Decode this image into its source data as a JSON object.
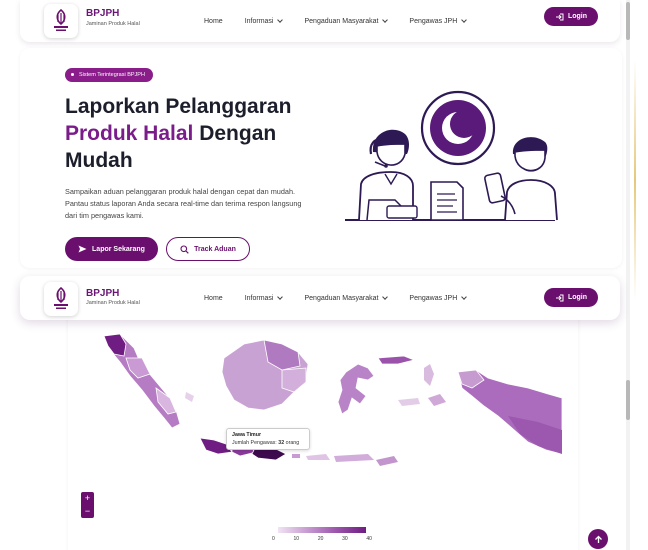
{
  "brand": {
    "name": "BPJPH",
    "subtitle": "Jaminan Produk Halal",
    "logo_icon": "halal-logo-icon"
  },
  "nav": {
    "items": [
      {
        "label": "Home",
        "has_dropdown": false
      },
      {
        "label": "Informasi",
        "has_dropdown": true
      },
      {
        "label": "Pengaduan Masyarakat",
        "has_dropdown": true
      },
      {
        "label": "Pengawas JPH",
        "has_dropdown": true
      }
    ],
    "login_label": "Login"
  },
  "hero": {
    "badge": "Sistem Terintegrasi BPJPH",
    "title_line1": "Laporkan Pelanggaran",
    "title_highlight": "Produk Halal",
    "title_line2_rest": " Dengan",
    "title_line3": "Mudah",
    "description": "Sampaikan aduan pelanggaran produk halal dengan cepat dan mudah. Pantau status laporan Anda secara real-time dan terima respon langsung dari tim pengawas kami.",
    "primary_button": "Lapor Sekarang",
    "secondary_button": "Track Aduan"
  },
  "map": {
    "tooltip_region": "Jawa Timur",
    "tooltip_label": "Jumlah Pengawas:",
    "tooltip_value": "32",
    "tooltip_unit": "orang",
    "zoom_in": "+",
    "zoom_out": "−",
    "legend_ticks": [
      "0",
      "10",
      "20",
      "30",
      "40"
    ],
    "colors": {
      "low": "#f0e4f3",
      "mid": "#b77cc6",
      "high": "#5a0a6e",
      "none": "#eeeeee"
    }
  },
  "scroll_top_icon": "arrow-up-icon",
  "theme": {
    "primary": "#6a0f6e",
    "accent": "#7a1d8a"
  }
}
